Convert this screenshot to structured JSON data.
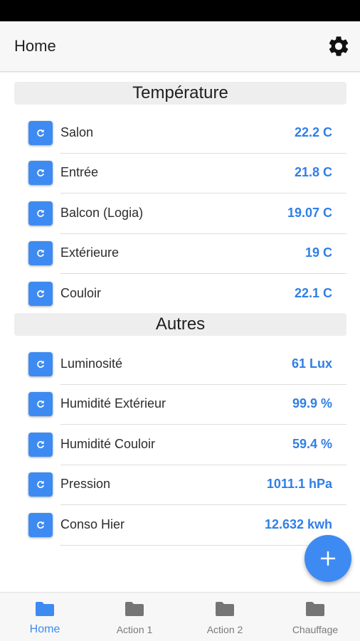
{
  "app_bar": {
    "title": "Home",
    "settings_icon": "gear-icon"
  },
  "sections": [
    {
      "title": "Température",
      "rows": [
        {
          "label": "Salon",
          "value": "22.2 C"
        },
        {
          "label": "Entrée",
          "value": "21.8 C"
        },
        {
          "label": "Balcon (Logia)",
          "value": "19.07 C"
        },
        {
          "label": "Extérieure",
          "value": "19 C"
        },
        {
          "label": "Couloir",
          "value": "22.1 C"
        }
      ]
    },
    {
      "title": "Autres",
      "rows": [
        {
          "label": "Luminosité",
          "value": "61 Lux"
        },
        {
          "label": "Humidité Extérieur",
          "value": "99.9 %"
        },
        {
          "label": "Humidité Couloir",
          "value": "59.4 %"
        },
        {
          "label": "Pression",
          "value": "1011.1 hPa"
        },
        {
          "label": "Conso Hier",
          "value": "12.632 kwh"
        }
      ]
    }
  ],
  "row_icon": "refresh-icon",
  "fab": {
    "icon": "plus-icon"
  },
  "bottom_nav": {
    "items": [
      {
        "label": "Home",
        "active": true,
        "icon": "folder-icon"
      },
      {
        "label": "Action 1",
        "active": false,
        "icon": "folder-icon"
      },
      {
        "label": "Action 2",
        "active": false,
        "icon": "folder-icon"
      },
      {
        "label": "Chauffage",
        "active": false,
        "icon": "folder-icon"
      }
    ]
  },
  "colors": {
    "accent": "#3d8bf2",
    "value_text": "#2f7fe6",
    "section_bg": "#eeeeee",
    "bar_bg": "#f7f7f7",
    "status_bar": "#000000"
  }
}
